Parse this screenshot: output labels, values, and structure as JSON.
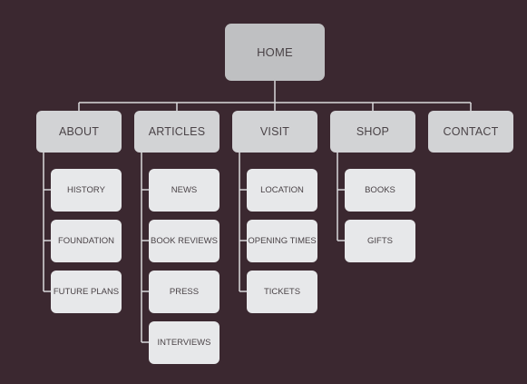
{
  "home": {
    "label": "HOME"
  },
  "sections": [
    {
      "label": "ABOUT",
      "pages": [
        "HISTORY",
        "FOUNDATION",
        "FUTURE PLANS"
      ]
    },
    {
      "label": "ARTICLES",
      "pages": [
        "NEWS",
        "BOOK REVIEWS",
        "PRESS",
        "INTERVIEWS"
      ]
    },
    {
      "label": "VISIT",
      "pages": [
        "LOCATION",
        "OPENING TIMES",
        "TICKETS"
      ]
    },
    {
      "label": "SHOP",
      "pages": [
        "BOOKS",
        "GIFTS"
      ]
    },
    {
      "label": "CONTACT",
      "pages": []
    }
  ]
}
